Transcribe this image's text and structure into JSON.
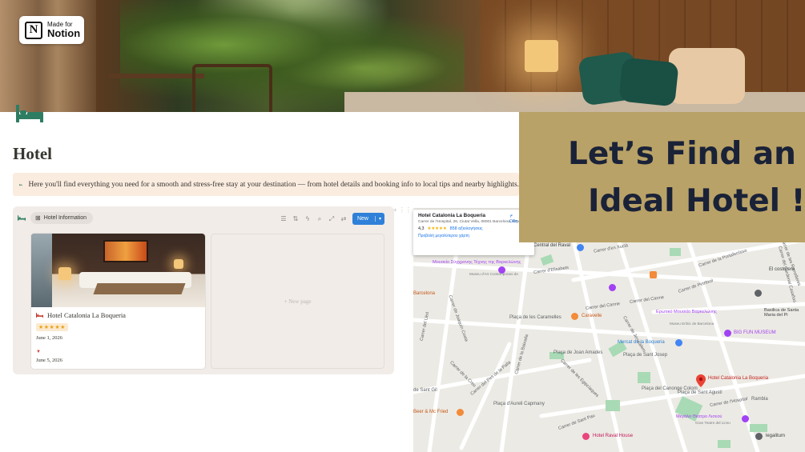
{
  "badge": {
    "small": "Made for",
    "big": "Notion",
    "logo_letter": "N"
  },
  "page": {
    "title": "Hotel",
    "callout": "Here you'll find everything you need for a smooth and stress-free stay at your destination — from hotel details and booking info to local tips and nearby highlights."
  },
  "database": {
    "view_label": "Hotel Information",
    "new_label": "New",
    "tools": [
      "filter-icon",
      "sort-icon",
      "lightning-icon",
      "search-icon",
      "expand-icon",
      "settings-icon"
    ],
    "cards": [
      {
        "title": "Hotel Catalonia La Boqueria",
        "rating": "★★★★★",
        "date_start": "June 1, 2026",
        "date_end": "June 5, 2026"
      }
    ],
    "new_page_label": "+ New page"
  },
  "map": {
    "popup": {
      "title": "Hotel Catalonia La Boqueria",
      "address": "Carrer de l'Hospital, 26, Ciutat Vella, 08001 Barcelona, Ισπανία",
      "rating": "4,3",
      "stars": "★★★★★",
      "reviews": "858 αξιολογήσεις",
      "link": "Προβολή μεγαλύτερου χάρτη",
      "side": "Οδη"
    },
    "labels": {
      "raval": "Central del Raval",
      "museum_gr": "Μουσείο Σύγχρονης Τέχνης της Βαρκελώνης",
      "museum_sub": "Museu d'Art Contemporani de",
      "barcelona": "Barcelona",
      "caramelles": "Plaça de les Caramelles",
      "caravelle": "Caravelle",
      "erotic_gr": "Ερωτικό Μουσείο Βαρκελώνης",
      "erotic_sub": "Museu Eròtic de Barcelona",
      "big_fun": "BIG FUN MUSEUM",
      "mercat": "Mercat de la Boqueria",
      "joan": "Plaça de Joan Amades",
      "josep": "Plaça de Sant Josep",
      "hotel_pin": "Hotel Catalonia La Boqueria",
      "canonge": "Plaça del Canonge Colom",
      "agusti": "Plaça de Sant Agustí",
      "aurelli": "Plaça d'Aureli Capmany",
      "beer": "Beer & Mc Fried",
      "sant_gil": "de Sant Gil",
      "liceu_gr": "Μεγάλο Θέατρο Λισεού",
      "liceu_sub": "Gran Teatre del Liceu",
      "raval_house": "Hotel Raval House",
      "rambla": "Rambla",
      "legalitum": "legalitum",
      "costurero": "El costurero",
      "basilica": "Basilica de Santa Maria del Pi",
      "street_ramelleres": "Carrer de les Ramelleres",
      "street_xucla": "Carrer d'en Xuclà",
      "street_elisabets": "Carrer d'Elisabets",
      "street_petritxol": "Carrer de Petritxol",
      "street_portaferrissa": "Carrer de la Portaferrissa",
      "street_cardenal": "Carrer del Cardenal Casañas",
      "street_carme": "Carrer del Carme",
      "street_carme2": "Carrer del Carme",
      "street_costa": "Carrer de Joaquín Costa",
      "street_lleo": "Carrer del Lleó",
      "street_pes": "Carrer del Pes de la Palla",
      "street_creu": "Carrer de la Creu",
      "street_hospital": "Carrer de l'Hospital",
      "street_egipciaques": "Carrer de les Egipcíaques",
      "street_jerusalem": "Carrer de Jerusalem",
      "street_baixada": "Carrer de la Baixada",
      "street_lluna": "Carrer de la Lluna",
      "street_riera": "Carrer de la Riera Baixa",
      "street_sant_pau": "Carrer de Sant Pau"
    }
  },
  "banner": {
    "line1": "Let’s Find an",
    "line2": "Ideal Hotel !"
  },
  "colors": {
    "banner_bg": "#b9a267",
    "banner_text": "#1a2238",
    "accent_green": "#2e7d63",
    "new_button": "#2f80d8"
  }
}
